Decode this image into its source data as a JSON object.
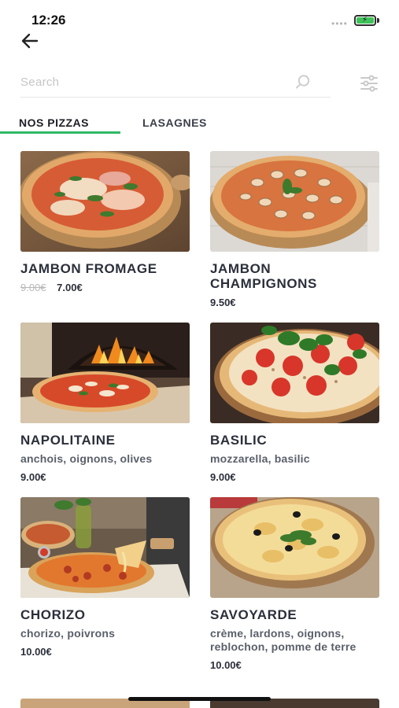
{
  "status_bar": {
    "time": "12:26",
    "battery_color": "#3fc25a"
  },
  "search": {
    "placeholder": "Search",
    "value": ""
  },
  "tabs": [
    {
      "label": "NOS PIZZAS",
      "active": true
    },
    {
      "label": "LASAGNES",
      "active": false
    }
  ],
  "accent_color": "#2fb866",
  "products": [
    {
      "name": "JAMBON FROMAGE",
      "description": "",
      "old_price": "9.00€",
      "price": "7.00€"
    },
    {
      "name": "JAMBON CHAMPIGNONS",
      "description": "",
      "old_price": "",
      "price": "9.50€"
    },
    {
      "name": "NAPOLITAINE",
      "description": "anchois, oignons, olives",
      "old_price": "",
      "price": "9.00€"
    },
    {
      "name": "BASILIC",
      "description": "mozzarella, basilic",
      "old_price": "",
      "price": "9.00€"
    },
    {
      "name": "CHORIZO",
      "description": "chorizo, poivrons",
      "old_price": "",
      "price": "10.00€"
    },
    {
      "name": "SAVOYARDE",
      "description": "crème, lardons, oignons, reblochon, pomme de terre",
      "old_price": "",
      "price": "10.00€"
    }
  ],
  "icons": {
    "back": "arrow-left-icon",
    "search": "search-icon",
    "filter": "sliders-icon"
  }
}
